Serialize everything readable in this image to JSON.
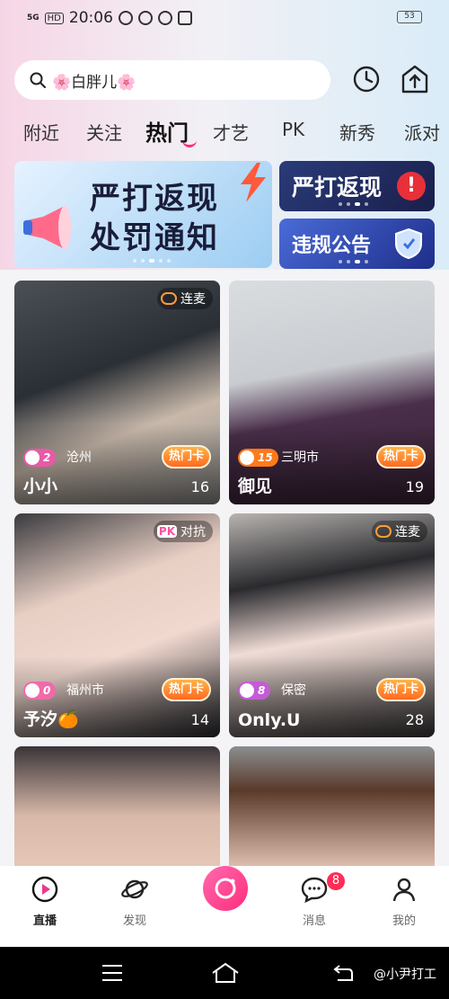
{
  "status_bar": {
    "network": "5G",
    "hd": "HD",
    "time": "20:06",
    "battery": "53"
  },
  "search": {
    "placeholder": "🌸白胖儿🌸"
  },
  "tabs": [
    {
      "label": "附近"
    },
    {
      "label": "关注"
    },
    {
      "label": "热门"
    },
    {
      "label": "才艺"
    },
    {
      "label": "PK"
    },
    {
      "label": "新秀"
    },
    {
      "label": "派对"
    }
  ],
  "active_tab": "热门",
  "banners": {
    "main_line1": "严打返现",
    "main_line2": "处罚通知",
    "side1": "严打返现",
    "side2": "违规公告"
  },
  "cards": [
    {
      "tag": "连麦",
      "level": "2",
      "city": "沧州",
      "hot": "热门卡",
      "name": "小小",
      "count": "16",
      "tag_color": "#ff9a3c",
      "level_color": "#e85aa6"
    },
    {
      "tag": "",
      "level": "15",
      "city": "三明市",
      "hot": "热门卡",
      "name": "御见",
      "count": "19",
      "tag_color": "",
      "level_color": "#ff7a1a"
    },
    {
      "tag": "对抗",
      "tag_badge": "PK",
      "level": "0",
      "city": "福州市",
      "hot": "热门卡",
      "name": "予汐🍊",
      "count": "14",
      "tag_color": "#ff4fa0",
      "level_color": "#f06aa8"
    },
    {
      "tag": "连麦",
      "level": "8",
      "city": "保密",
      "hot": "热门卡",
      "name": "Only.U",
      "count": "28",
      "tag_color": "#ff9a3c",
      "level_color": "#c65ad8"
    }
  ],
  "nav": {
    "live": "直播",
    "discover": "发现",
    "messages": "消息",
    "me": "我的",
    "message_badge": "8"
  },
  "watermark": "@小尹打工",
  "colors": {
    "accent": "#ff2d7a",
    "hot_card": "#ff6a1f",
    "banner_dark": "#1a1f4a"
  }
}
